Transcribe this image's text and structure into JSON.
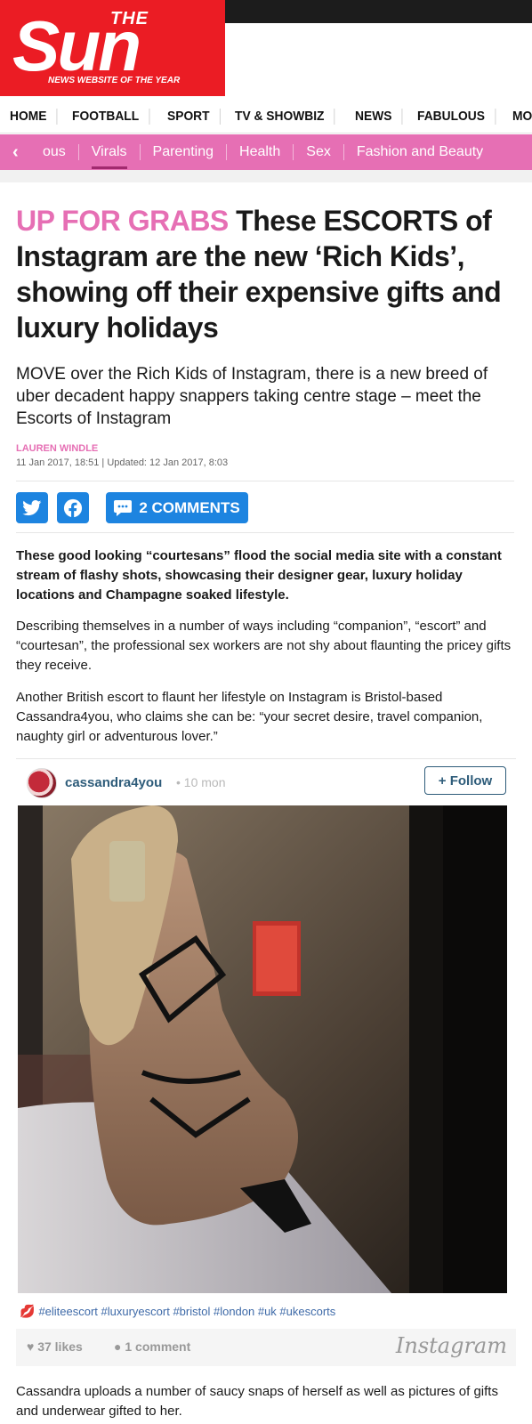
{
  "brand": {
    "logo_top": "THE",
    "logo_main": "Sun",
    "tagline": "NEWS WEBSITE OF THE YEAR",
    "red": "#eb1c24",
    "pink": "#e66fb4"
  },
  "main_nav": [
    "HOME",
    "FOOTBALL",
    "SPORT",
    "TV & SHOWBIZ",
    "NEWS",
    "FABULOUS",
    "MONEY"
  ],
  "sub_nav": {
    "items": [
      "ous",
      "Virals",
      "Parenting",
      "Health",
      "Sex",
      "Fashion and Beauty"
    ],
    "active": "Virals"
  },
  "article": {
    "kicker": "UP FOR GRABS",
    "headline": "These ESCORTS of Instagram are the new ‘Rich Kids’, showing off their expensive gifts and luxury holidays",
    "standfirst": "MOVE over the Rich Kids of Instagram, there is a new breed of uber decadent happy snappers taking centre stage – meet the Escorts of Instagram",
    "author": "LAUREN WINDLE",
    "dates": "11 Jan 2017, 18:51 | Updated: 12 Jan 2017, 8:03",
    "comments_button": "2 COMMENTS",
    "lead": "These good looking “courtesans” flood the social media site with a constant stream of flashy shots, showcasing their designer gear, luxury holiday locations and Champagne soaked lifestyle.",
    "para1": "Describing themselves in a number of ways including “companion”, “escort” and “courtesan”, the professional sex workers are not shy about flaunting the pricey gifts they receive.",
    "para2": "Another British escort to flaunt her lifestyle on Instagram is Bristol-based Cassandra4you, who claims she can be: “your secret desire, travel companion, naughty girl or adventurous lover.”",
    "para3": "Cassandra uploads a number of saucy snaps of herself as well as pictures of gifts and underwear gifted to her."
  },
  "instagram": {
    "username": "cassandra4you",
    "time": "• 10 mon",
    "follow_label": "+ Follow",
    "tags": "#eliteescort #luxuryescort #bristol #london #uk #ukescorts",
    "likes": "37 likes",
    "comments": "1 comment",
    "brand": "Instagram"
  }
}
